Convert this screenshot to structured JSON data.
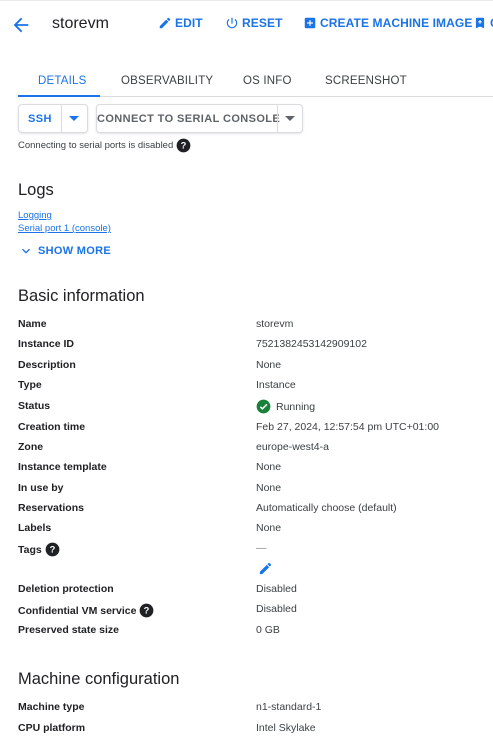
{
  "header": {
    "title": "storevm",
    "actions": {
      "edit": "EDIT",
      "reset": "RESET",
      "create_machine_image": "CREATE MACHINE IMAGE",
      "overflow": "C"
    }
  },
  "tabs": [
    "DETAILS",
    "OBSERVABILITY",
    "OS INFO",
    "SCREENSHOT"
  ],
  "active_tab": "DETAILS",
  "connect": {
    "ssh": "SSH",
    "serial_console": "CONNECT TO SERIAL CONSOLE",
    "serial_hint": "Connecting to serial ports is disabled"
  },
  "logs": {
    "title": "Logs",
    "links": [
      "Logging",
      "Serial port 1 (console)"
    ],
    "show_more": "SHOW MORE"
  },
  "basic": {
    "title": "Basic information",
    "rows": [
      {
        "label": "Name",
        "value": "storevm"
      },
      {
        "label": "Instance ID",
        "value": "7521382453142909102"
      },
      {
        "label": "Description",
        "value": "None"
      },
      {
        "label": "Type",
        "value": "Instance"
      },
      {
        "label": "Status",
        "value": "Running"
      },
      {
        "label": "Creation time",
        "value": "Feb 27, 2024, 12:57:54 pm UTC+01:00"
      },
      {
        "label": "Zone",
        "value": "europe-west4-a"
      },
      {
        "label": "Instance template",
        "value": "None"
      },
      {
        "label": "In use by",
        "value": "None"
      },
      {
        "label": "Reservations",
        "value": "Automatically choose (default)"
      },
      {
        "label": "Labels",
        "value": "None"
      },
      {
        "label": "Tags",
        "value": "—"
      },
      {
        "label": "Deletion protection",
        "value": "Disabled"
      },
      {
        "label": "Confidential VM service",
        "value": "Disabled"
      },
      {
        "label": "Preserved state size",
        "value": "0 GB"
      }
    ]
  },
  "machine": {
    "title": "Machine configuration",
    "rows": [
      {
        "label": "Machine type",
        "value": "n1-standard-1"
      },
      {
        "label": "CPU platform",
        "value": "Intel Skylake"
      }
    ]
  },
  "colors": {
    "accent": "#1a73e8",
    "running": "#188038",
    "text": "#202124",
    "divider": "#dadce0"
  },
  "icons": [
    "back-arrow-icon",
    "edit-icon",
    "reset-icon",
    "add-box-icon",
    "chevron-down-icon",
    "help-icon",
    "check-circle-icon"
  ]
}
